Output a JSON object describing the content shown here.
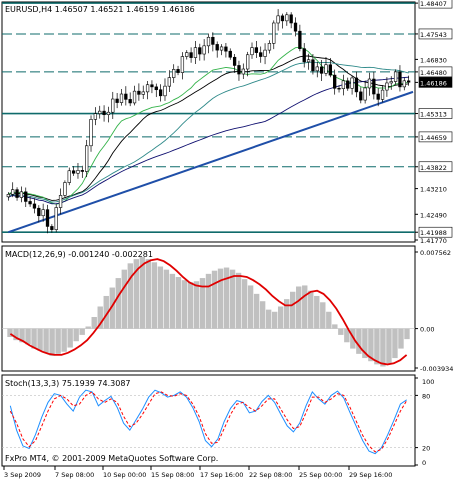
{
  "symbol_header": "EURUSD,H4  1.46507 1.46521 1.46159 1.46186",
  "macd_header": "MACD(12,26,9) -0.001240 -0.002281",
  "stoch_header": "Stoch(13,3,3) 75.1939 74.3087",
  "copyright": "FxPro MT4, © 2001-2009 MetaQuotes Software Corp.",
  "colors": {
    "background": "#ffffff",
    "grid": "#c0c0c0",
    "candle": "#000000",
    "trendline": "#1f4fa8",
    "support_level": "#0f6b6b",
    "ma_black": "#000000",
    "ma_green": "#34b34a",
    "ma_navy": "#101070",
    "ma_teal": "#2f8a8a",
    "macd_hist": "#c0c0c0",
    "macd_signal": "#e00000",
    "stoch_main": "#1e8fff",
    "stoch_signal": "#ff0000"
  },
  "chart_data": [
    {
      "type": "candlestick",
      "title": "EURUSD,H4",
      "ohlc_header": {
        "open": 1.46507,
        "high": 1.46521,
        "low": 1.46159,
        "close": 1.46186
      },
      "y_tick_labels": [
        "1.48407",
        "1.47543",
        "1.46830",
        "1.46480",
        "1.46186",
        "1.45313",
        "1.44659",
        "1.43822",
        "1.43210",
        "1.42490",
        "1.41988",
        "1.41770"
      ],
      "ylim": [
        1.4177,
        1.4841
      ],
      "x_tick_labels": [
        "3 Sep 2009",
        "7 Sep 08:00",
        "10 Sep 00:00",
        "15 Sep 08:00",
        "17 Sep 16:00",
        "22 Sep 08:00",
        "25 Sep 00:00",
        "29 Sep 16:00"
      ],
      "horizontal_levels": [
        1.48407,
        1.47543,
        1.4648,
        1.45313,
        1.44659,
        1.43822,
        1.41988
      ],
      "highlighted_price": 1.46186,
      "trendlines": [
        {
          "from": 1.4199,
          "to": 1.4592,
          "bars_from": 0,
          "bars_to": 93
        }
      ],
      "closes": [
        1.4305,
        1.4318,
        1.4296,
        1.4312,
        1.4285,
        1.4278,
        1.4266,
        1.4245,
        1.4262,
        1.4215,
        1.4206,
        1.4268,
        1.4302,
        1.4338,
        1.4371,
        1.4364,
        1.4372,
        1.4369,
        1.4441,
        1.4515,
        1.4531,
        1.4538,
        1.4528,
        1.4535,
        1.4572,
        1.4562,
        1.4586,
        1.4571,
        1.4561,
        1.4594,
        1.4585,
        1.4592,
        1.4612,
        1.4606,
        1.4598,
        1.4581,
        1.4608,
        1.4632,
        1.4655,
        1.4646,
        1.4691,
        1.4702,
        1.4688,
        1.4716,
        1.4698,
        1.4721,
        1.4745,
        1.4725,
        1.4709,
        1.4718,
        1.4706,
        1.4689,
        1.4666,
        1.4642,
        1.4656,
        1.4696,
        1.4716,
        1.4702,
        1.4691,
        1.4709,
        1.4728,
        1.4785,
        1.4805,
        1.4791,
        1.4808,
        1.4785,
        1.4762,
        1.4713,
        1.4676,
        1.4682,
        1.4651,
        1.4662,
        1.4644,
        1.4668,
        1.4639,
        1.4602,
        1.4601,
        1.4623,
        1.4602,
        1.4631,
        1.4592,
        1.4569,
        1.4603,
        1.4628,
        1.4586,
        1.4571,
        1.4597,
        1.4617,
        1.4621,
        1.4648,
        1.4606,
        1.4623,
        1.4619
      ],
      "moving_averages": [
        {
          "color": "ma_black",
          "start": 1.43,
          "end": 1.4635,
          "peak": 1.4652
        },
        {
          "color": "ma_green",
          "start": 1.431,
          "end": 1.4642,
          "peak": 1.466
        },
        {
          "color": "ma_teal",
          "start": 1.428,
          "end": 1.4636
        },
        {
          "color": "ma_navy",
          "start": 1.427,
          "end": 1.453
        }
      ]
    },
    {
      "type": "bar",
      "title": "MACD(12,26,9)",
      "values_header": {
        "macd": -0.00124,
        "signal": -0.002281
      },
      "y_tick_labels": [
        "0.007562",
        "0.00",
        "-0.003934"
      ],
      "ylim": [
        -0.003934,
        0.007562
      ],
      "histogram": [
        -0.0008,
        -0.0011,
        -0.0013,
        -0.0015,
        -0.0019,
        -0.0021,
        -0.0023,
        -0.0026,
        -0.0024,
        -0.0022,
        -0.0018,
        -0.0012,
        -0.0006,
        0.0002,
        0.0011,
        0.0021,
        0.0031,
        0.0039,
        0.0048,
        0.0056,
        0.0062,
        0.0066,
        0.0068,
        0.0066,
        0.0063,
        0.0059,
        0.0056,
        0.0052,
        0.0049,
        0.0046,
        0.0044,
        0.0045,
        0.0048,
        0.0052,
        0.0055,
        0.0057,
        0.0058,
        0.0056,
        0.0053,
        0.0047,
        0.0041,
        0.0033,
        0.0026,
        0.0018,
        0.0016,
        0.0021,
        0.0028,
        0.0035,
        0.004,
        0.0041,
        0.0036,
        0.0031,
        0.0025,
        0.0016,
        0.0004,
        -0.0006,
        -0.0013,
        -0.0019,
        -0.0024,
        -0.0028,
        -0.0031,
        -0.0034,
        -0.0036,
        -0.0033,
        -0.0028,
        -0.0019,
        -0.001
      ],
      "signal": [
        -0.0005,
        -0.0009,
        -0.0012,
        -0.0016,
        -0.0019,
        -0.0022,
        -0.0024,
        -0.0025,
        -0.0025,
        -0.0023,
        -0.002,
        -0.0016,
        -0.0011,
        -0.0004,
        0.0004,
        0.0013,
        0.0022,
        0.0032,
        0.0041,
        0.005,
        0.0057,
        0.0062,
        0.0065,
        0.0066,
        0.0064,
        0.006,
        0.0055,
        0.0049,
        0.0044,
        0.0041,
        0.004,
        0.004,
        0.0043,
        0.0046,
        0.0048,
        0.005,
        0.005,
        0.0049,
        0.0046,
        0.0042,
        0.0037,
        0.0031,
        0.0026,
        0.0022,
        0.0022,
        0.0026,
        0.0031,
        0.0035,
        0.0036,
        0.0033,
        0.0027,
        0.0019,
        0.0009,
        -0.0002,
        -0.0012,
        -0.002,
        -0.0026,
        -0.003,
        -0.0033,
        -0.0034,
        -0.0033,
        -0.003,
        -0.0025
      ]
    },
    {
      "type": "line",
      "title": "Stoch(13,3,3)",
      "values_header": {
        "main": 75.1939,
        "signal": 74.3087
      },
      "y_tick_labels": [
        "100",
        "80",
        "20",
        "0"
      ],
      "ylim": [
        0,
        100
      ],
      "series": [
        {
          "color": "stoch_main",
          "values": [
            68,
            40,
            22,
            19,
            35,
            55,
            72,
            82,
            80,
            70,
            62,
            78,
            86,
            84,
            68,
            74,
            79,
            66,
            48,
            40,
            52,
            64,
            78,
            86,
            83,
            78,
            80,
            84,
            78,
            66,
            50,
            28,
            21,
            30,
            50,
            65,
            74,
            72,
            60,
            62,
            73,
            80,
            72,
            58,
            45,
            38,
            48,
            68,
            84,
            76,
            70,
            80,
            85,
            77,
            60,
            44,
            28,
            16,
            13,
            20,
            35,
            52,
            70,
            75
          ]
        },
        {
          "color": "stoch_signal",
          "values": [
            62,
            48,
            30,
            21,
            28,
            45,
            62,
            76,
            80,
            76,
            68,
            70,
            80,
            84,
            76,
            72,
            76,
            72,
            56,
            44,
            48,
            58,
            70,
            82,
            84,
            80,
            79,
            82,
            80,
            70,
            56,
            36,
            25,
            26,
            42,
            58,
            70,
            72,
            66,
            62,
            68,
            76,
            76,
            64,
            52,
            42,
            44,
            60,
            78,
            78,
            72,
            76,
            82,
            80,
            66,
            50,
            34,
            22,
            15,
            18,
            30,
            46,
            62,
            74
          ]
        }
      ]
    }
  ]
}
